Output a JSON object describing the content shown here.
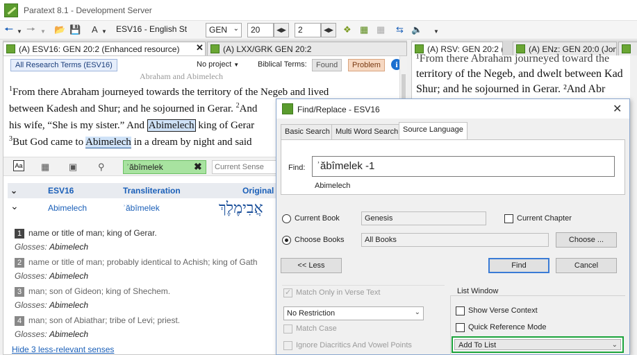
{
  "window": {
    "title": "Paratext 8.1 - Development Server"
  },
  "toolbar": {
    "font_size_label": "A",
    "resource": "ESV16  - English St",
    "book": "GEN",
    "chapter": "20",
    "verse": "2"
  },
  "tabs_left": [
    {
      "label": "(A) ESV16: GEN 20:2 (Enhanced resource)"
    },
    {
      "label": "(A) LXX/GRK GEN 20:2"
    }
  ],
  "tabs_right": [
    {
      "label": "(A) RSV: GEN 20:2 (Re"
    },
    {
      "label": "(A) ENz: GEN 20:0 (Jona"
    },
    {
      "label": ""
    }
  ],
  "research": {
    "terms_button": "All Research Terms (ESV16)",
    "no_project": "No project",
    "biblical_terms_label": "Biblical Terms:",
    "found_button": "Found",
    "problem_button": "Problem",
    "info": "i"
  },
  "scripture": {
    "heading_faint": "Abraham and Abimelech",
    "lines": [
      {
        "vn": "1",
        "text": "From there Abraham journeyed towards the territory of the Negeb and lived"
      },
      {
        "text": "between Kadesh and Shur; and he sojourned in Gerar. ",
        "vn2": "2",
        "tail": "And"
      },
      {
        "pre": "his wife, “She is my sister.” And ",
        "hl": "Abimelech",
        "post": " king of Gerar"
      },
      {
        "vn": "3",
        "pre": "But God came to ",
        "hl": "Abimelech",
        "post": " in a dream by night and said"
      }
    ]
  },
  "lexicon": {
    "search_value": "ʾăbîmelek",
    "current_sense_placeholder": "Current Sense",
    "columns": {
      "esv": "ESV16",
      "translit": "Transliteration",
      "original": "Original"
    },
    "entry": {
      "word": "Abimelech",
      "translit": "ʾăbîmelek",
      "hebrew": "אֲבִימֶלֶךְ"
    },
    "senses": [
      {
        "n": "1",
        "text": "name or title of man; king of Gerar.",
        "gloss_label": "Glosses:",
        "gloss": "Abimelech"
      },
      {
        "n": "2",
        "text": "name or title of man; probably identical to Achish; king of Gath",
        "gloss_label": "Glosses:",
        "gloss": "Abimelech"
      },
      {
        "n": "3",
        "text": "man; son of Gideon; king of Shechem.",
        "gloss_label": "Glosses:",
        "gloss": "Abimelech"
      },
      {
        "n": "4",
        "text": "man; son of Abiathar; tribe of Levi; priest.",
        "gloss_label": "Glosses:",
        "gloss": "Abimelech"
      }
    ],
    "hide_link": "Hide 3 less-relevant senses"
  },
  "right_scripture": {
    "lines": [
      "¹From there Abraham journeyed toward the",
      "territory of the Negeb, and dwelt between Kad",
      "Shur; and he sojourned in Gerar. ²And Abr"
    ]
  },
  "dialog": {
    "title": "Find/Replace - ESV16",
    "tabs": [
      "Basic Search",
      "Multi Word Search",
      "Source Language"
    ],
    "find_label": "Find:",
    "find_value": "ʾăbîmelek -1",
    "find_gloss": "Abimelech",
    "current_book_label": "Current Book",
    "current_book_value": "Genesis",
    "current_chapter_label": "Current Chapter",
    "choose_books_label": "Choose Books",
    "choose_books_value": "All Books",
    "choose_button": "Choose ...",
    "less_button": "<< Less",
    "find_button": "Find",
    "cancel_button": "Cancel",
    "match_verse_label": "Match Only in Verse Text",
    "restriction_value": "No Restriction",
    "match_case_label": "Match Case",
    "ignore_diacritics_label": "Ignore Diacritics And Vowel Points",
    "list_window_label": "List Window",
    "show_verse_context_label": "Show Verse Context",
    "quick_ref_label": "Quick Reference Mode",
    "add_to_list_value": "Add To List"
  }
}
